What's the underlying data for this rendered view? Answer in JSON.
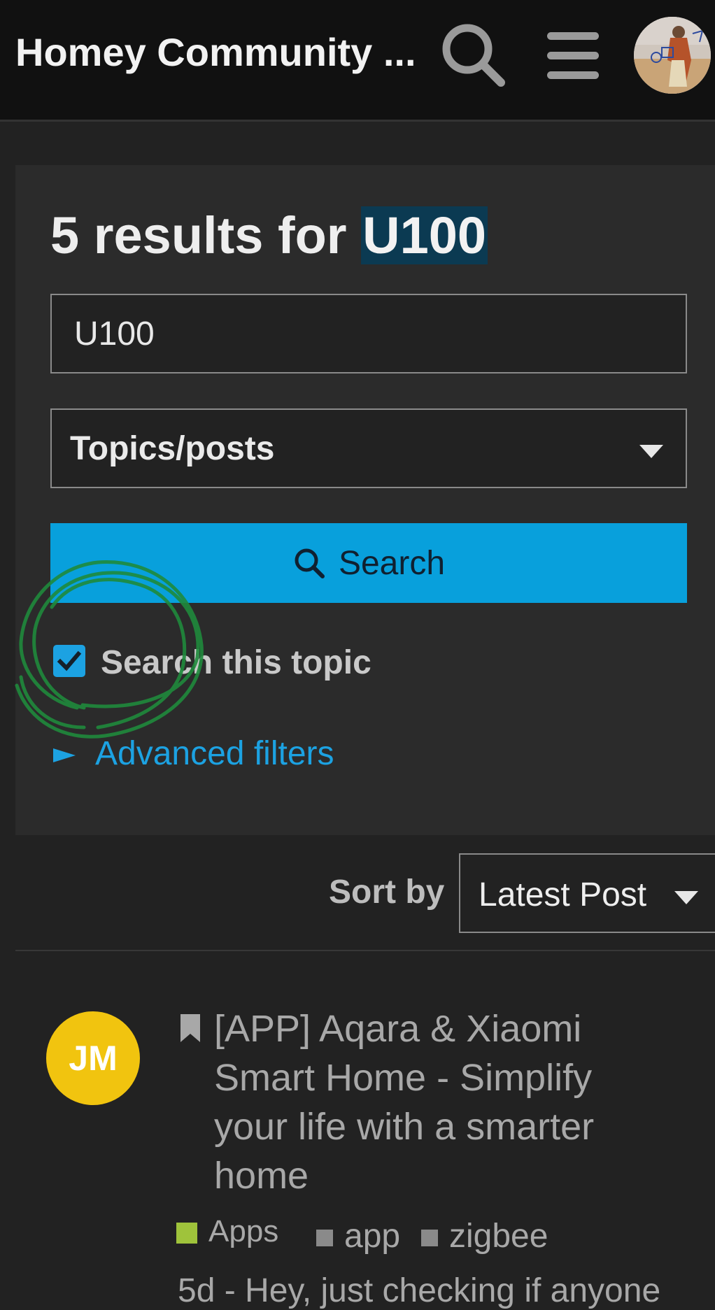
{
  "header": {
    "site_title": "Homey Community ...",
    "search_icon": "search-icon",
    "menu_icon": "hamburger-menu-icon",
    "avatar_icon": "user-avatar"
  },
  "search": {
    "heading_prefix": "5 results for ",
    "heading_term": "U100",
    "input_value": "U100",
    "type_select": "Topics/posts",
    "button_label": "Search",
    "checkbox_checked": true,
    "checkbox_label": "Search this topic",
    "advanced_filters_label": "Advanced filters"
  },
  "sort": {
    "label": "Sort by",
    "selected": "Latest Post"
  },
  "results": [
    {
      "avatar_initials": "JM",
      "title": "[APP] Aqara & Xiaomi Smart Home - Simplify your life with a smarter home",
      "category": "Apps",
      "tags": [
        "app",
        "zigbee"
      ],
      "blurb": "5d - Hey, just checking if anyone"
    }
  ],
  "colors": {
    "accent": "#08a0dc",
    "link": "#1ca2e2",
    "highlight": "#0b3a52",
    "category_apps": "#9fc33b",
    "avatar_jm": "#f1c40f",
    "annotation": "#1f8a3c"
  }
}
